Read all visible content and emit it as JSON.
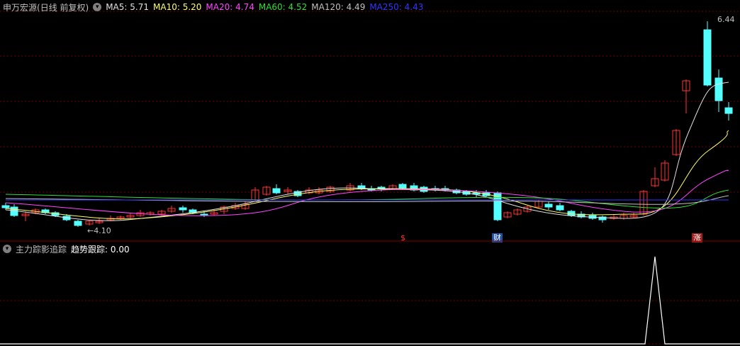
{
  "main_panel": {
    "stock_name": "申万宏源",
    "period": "(日线 前复权)",
    "indicators": [
      {
        "label": "MA5:",
        "value": "5.71",
        "color": "#e0e0e0"
      },
      {
        "label": "MA10:",
        "value": "5.20",
        "color": "#ffff66"
      },
      {
        "label": "MA20:",
        "value": "4.74",
        "color": "#ff44ff"
      },
      {
        "label": "MA60:",
        "value": "4.52",
        "color": "#33dd33"
      },
      {
        "label": "MA120:",
        "value": "4.49",
        "color": "#c0c0c0"
      },
      {
        "label": "MA250:",
        "value": "4.43",
        "color": "#3333ff"
      }
    ],
    "high_label": "6.44",
    "low_label": "←4.10",
    "markers": {
      "dollar": "$",
      "finance": "财",
      "rise": "涨"
    }
  },
  "sub_panel": {
    "title": "主力踪影追踪",
    "indicator_label": "趋势跟踪:",
    "indicator_value": "0.00"
  },
  "colors": {
    "up": "#ff3333",
    "down": "#54ffff",
    "grid": "#800000"
  }
}
